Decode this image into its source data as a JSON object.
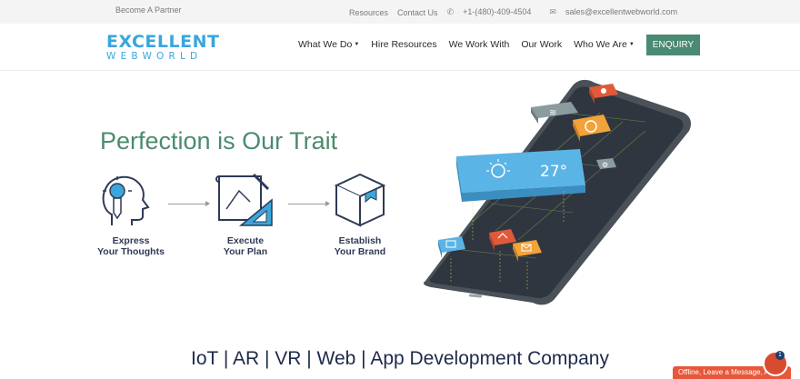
{
  "topbar": {
    "partner_link": "Become A Partner",
    "resources_link": "Resources",
    "contact_link": "Contact Us",
    "phone": "+1-(480)-409-4504",
    "email": "sales@excellentwebworld.com"
  },
  "logo": {
    "line1": "EXCELLENT",
    "line2": "WEBWORLD"
  },
  "nav": {
    "items": [
      {
        "label": "What We Do",
        "dropdown": true
      },
      {
        "label": "Hire Resources",
        "dropdown": false
      },
      {
        "label": "We Work With",
        "dropdown": false
      },
      {
        "label": "Our Work",
        "dropdown": false
      },
      {
        "label": "Who We Are",
        "dropdown": true
      }
    ],
    "cta": "ENQUIRY"
  },
  "hero": {
    "title": "Perfection is Our Trait",
    "steps": [
      {
        "line1": "Express",
        "line2": "Your Thoughts",
        "icon": "head-bulb-icon"
      },
      {
        "line1": "Execute",
        "line2": "Your Plan",
        "icon": "blueprint-icon"
      },
      {
        "line1": "Establish",
        "line2": "Your Brand",
        "icon": "box-icon"
      }
    ],
    "weather_temp": "27°"
  },
  "section": {
    "title": "IoT | AR | VR | Web | App Development Company"
  },
  "chat": {
    "label": "Offline, Leave a Message, And...",
    "badge": "1"
  },
  "colors": {
    "accent": "#4a8a72",
    "brand_blue": "#3aa6dc",
    "navy": "#1c2a4a",
    "chat": "#e8573a"
  }
}
